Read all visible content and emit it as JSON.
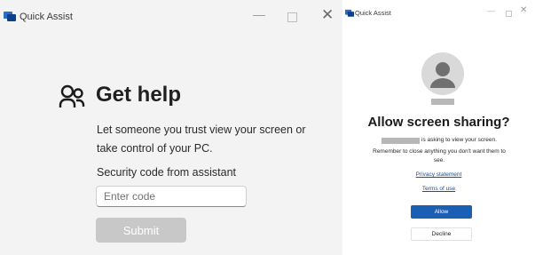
{
  "left_window": {
    "title": "Quick Assist",
    "heading": "Get help",
    "description": "Let someone you trust view your screen or take control of your PC.",
    "code_label": "Security code from assistant",
    "code_input": {
      "value": "",
      "placeholder": "Enter code"
    },
    "submit_label": "Submit",
    "icons": [
      "quick-assist-icon",
      "minimize-icon",
      "maximize-icon",
      "close-icon",
      "people-icon"
    ]
  },
  "right_window": {
    "title": "Quick Assist",
    "heading": "Allow screen sharing?",
    "asking_text": "is asking to view your screen.",
    "warning_text": "Remember to close anything you don't want them to see.",
    "privacy_link": "Privacy statement",
    "terms_link": "Terms of use",
    "allow_label": "Allow",
    "decline_label": "Decline",
    "icons": [
      "quick-assist-icon",
      "minimize-icon",
      "maximize-icon",
      "close-icon",
      "avatar-icon"
    ]
  },
  "colors": {
    "left_background": "#f3f3f3",
    "submit_disabled": "#c8c8c8",
    "allow_button": "#1a5fb4",
    "link": "#1a4fa0"
  }
}
